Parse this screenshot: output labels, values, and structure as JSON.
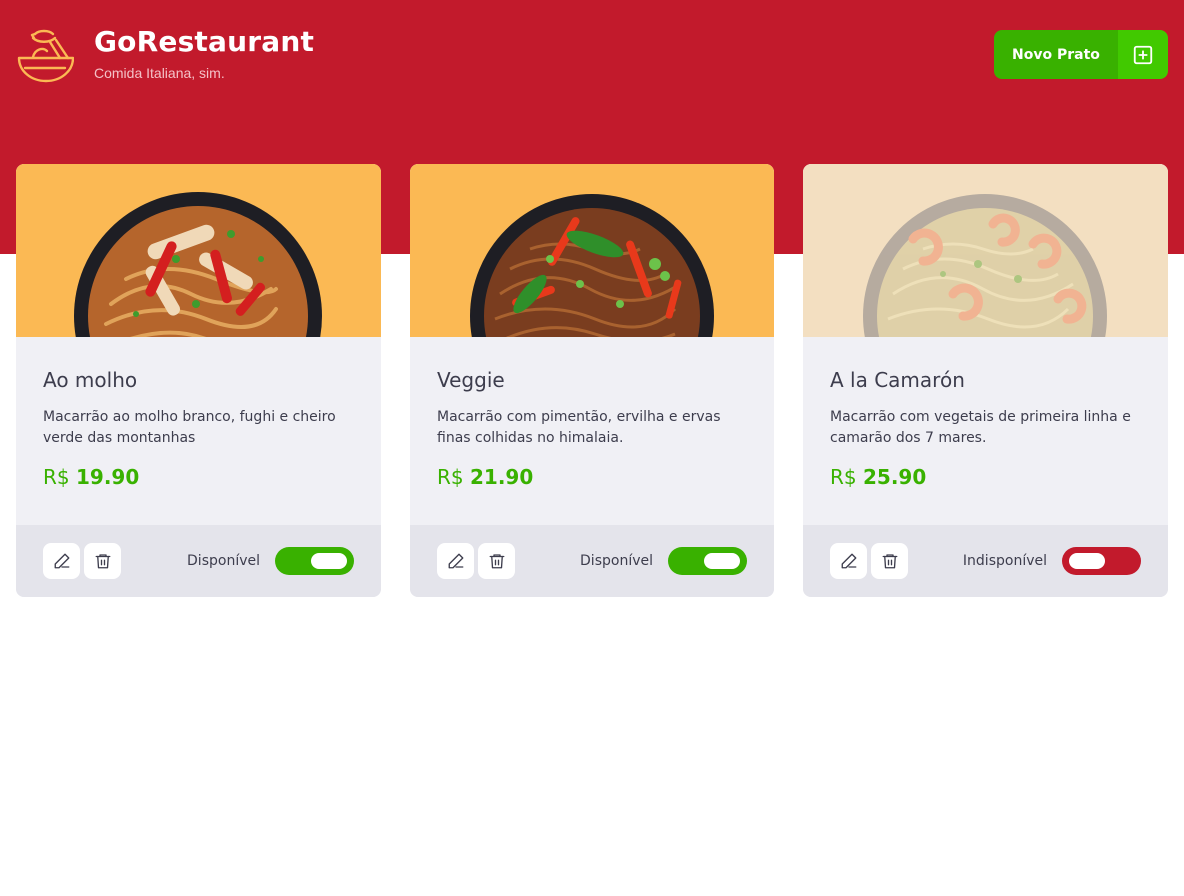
{
  "header": {
    "title": "GoRestaurant",
    "subtitle": "Comida Italiana, sim.",
    "new_button_label": "Novo Prato"
  },
  "colors": {
    "brand_red": "#c21a2c",
    "accent_green": "#39b100",
    "image_bg": "#fbb954"
  },
  "dishes": [
    {
      "name": "Ao molho",
      "description": "Macarrão ao molho branco, fughi e cheiro verde das montanhas",
      "currency": "R$",
      "price": "19.90",
      "status_label": "Disponível",
      "available": true
    },
    {
      "name": "Veggie",
      "description": "Macarrão com pimentão, ervilha e ervas finas colhidas no himalaia.",
      "currency": "R$",
      "price": "21.90",
      "status_label": "Disponível",
      "available": true
    },
    {
      "name": "A la Camarón",
      "description": "Macarrão com vegetais de primeira linha e camarão dos 7 mares.",
      "currency": "R$",
      "price": "25.90",
      "status_label": "Indisponível",
      "available": false
    }
  ],
  "icons": {
    "logo": "bowl-noodles-icon",
    "new_button": "plus-square-icon",
    "edit": "pencil-icon",
    "delete": "trash-icon"
  }
}
